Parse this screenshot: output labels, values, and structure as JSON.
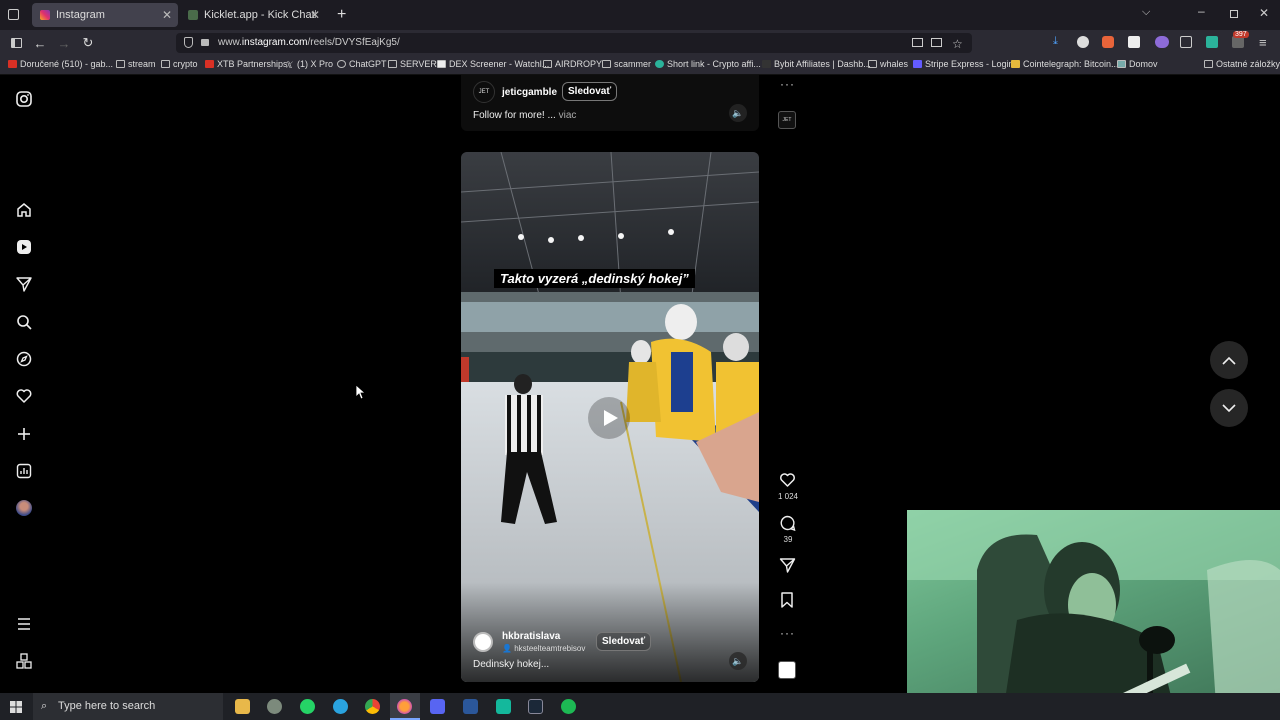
{
  "browser": {
    "tabs": [
      {
        "label": "Instagram",
        "active": true
      },
      {
        "label": "Kicklet.app - Kick Chatbot and &",
        "active": false
      }
    ],
    "url_prefix": "www.",
    "url_domain": "instagram.com",
    "url_path": "/reels/DVYSfEajKg5/",
    "bookmarks": [
      "Doručené (510) - gab...",
      "stream",
      "crypto",
      "XTB Partnerships",
      "(1) X Pro",
      "ChatGPT",
      "SERVER",
      "DEX Screener - Watchl...",
      "AIRDROPY",
      "scammer",
      "Short link - Crypto affi...",
      "Bybit Affiliates | Dashb...",
      "whales",
      "Stripe Express - Login",
      "Cointelegraph: Bitcoin...",
      "Domov",
      "Ostatné záložky"
    ],
    "extension_badge": "397"
  },
  "reel_top": {
    "username": "jeticgamble",
    "follow_label": "Sledovať",
    "caption": "Follow for more! ...",
    "more_label": "viac"
  },
  "reel_main": {
    "overlay_text": "Takto vyzerá „dedinský hokej”",
    "username": "hkbratislava",
    "collab": "hksteelteamtrebisov",
    "follow_label": "Sledovať",
    "caption": "Dedinsky hokej..."
  },
  "actions": {
    "likes": "1 024",
    "comments": "39"
  },
  "taskbar": {
    "search_placeholder": "Type here to search"
  },
  "colors": {
    "instagram_accent": "#e1306c",
    "tab_active": "#42414d",
    "toolbar": "#2b2a33"
  }
}
